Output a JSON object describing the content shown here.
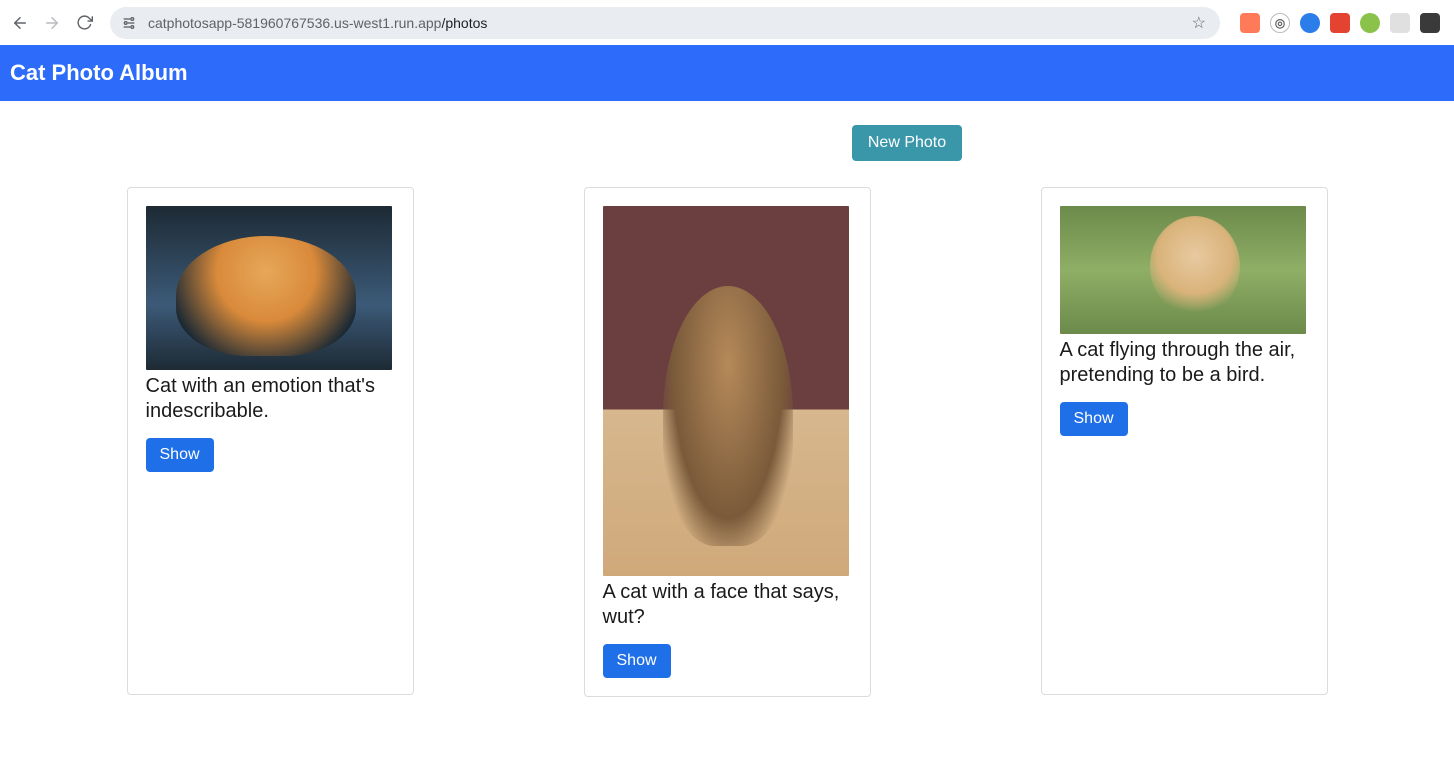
{
  "browser": {
    "url_prefix": "catphotosapp-581960767536.us-west1.run.app",
    "url_path": "/photos"
  },
  "app": {
    "title": "Cat Photo Album"
  },
  "actions": {
    "new_photo_label": "New Photo",
    "show_label": "Show"
  },
  "photos": [
    {
      "caption": "Cat with an emotion that's indescribable."
    },
    {
      "caption": "A cat with a face that says, wut?"
    },
    {
      "caption": "A cat flying through the air, pretending to be a bird."
    }
  ]
}
